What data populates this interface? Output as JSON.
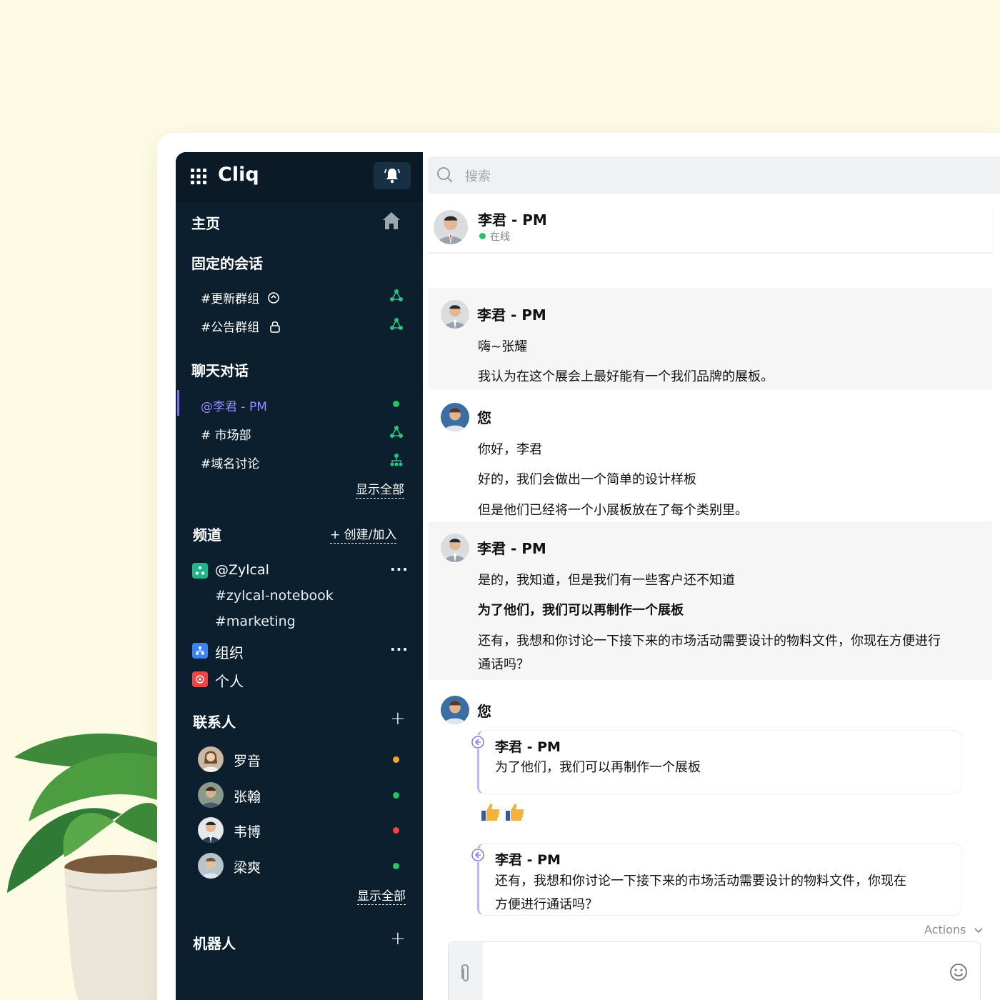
{
  "app": {
    "brand": "Cliq"
  },
  "sidebar": {
    "home": "主页",
    "pinned_title": "固定的会话",
    "pinned": [
      {
        "label": "#更新群组"
      },
      {
        "label": "#公告群组"
      }
    ],
    "chats_title": "聊天对话",
    "chats": [
      {
        "label": "@李君 - PM",
        "status_color": "#22c55e"
      },
      {
        "label": "# 市场部"
      },
      {
        "label": "#域名讨论"
      }
    ],
    "show_all": "显示全部",
    "channels_title": "频道",
    "create_join": "+   创建/加入",
    "channel_groups": [
      {
        "label": "@Zylcal",
        "color": "#1fb58a",
        "subs": [
          "#zylcal-notebook",
          "#marketing"
        ]
      },
      {
        "label": "组织",
        "color": "#3b82f6"
      },
      {
        "label": "个人",
        "color": "#ef4444"
      }
    ],
    "contacts_title": "联系人",
    "contacts": [
      {
        "name": "罗音",
        "status_color": "#f5a524"
      },
      {
        "name": "张翰",
        "status_color": "#22c55e"
      },
      {
        "name": "韦博",
        "status_color": "#ef4444"
      },
      {
        "name": "梁爽",
        "status_color": "#22c55e"
      }
    ],
    "show_all_contacts": "显示全部",
    "bots_title": "机器人"
  },
  "search": {
    "placeholder": "搜索"
  },
  "chat": {
    "header_name": "李君 - PM",
    "status": "在线",
    "messages": [
      {
        "sender": "李君 - PM",
        "lines": [
          "嗨~张耀",
          "我认为在这个展会上最好能有一个我们品牌的展板。"
        ]
      },
      {
        "sender": "您",
        "lines": [
          "你好，李君",
          "好的，我们会做出一个简单的设计样板",
          "但是他们已经将一个小展板放在了每个类别里。"
        ]
      },
      {
        "sender": "李君 - PM",
        "lines": [
          "是的，我知道，但是我们有一些客户还不知道",
          "为了他们，我们可以再制作一个展板",
          "还有，我想和你讨论一下接下来的市场活动需要设计的物料文件，你现在方便进行",
          "通话吗？"
        ]
      },
      {
        "sender": "您",
        "quotes": [
          {
            "name": "李君 - PM",
            "lines": [
              "为了他们，我们可以再制作一个展板"
            ]
          },
          {
            "name": "李君 - PM",
            "lines": [
              "还有，我想和你讨论一下接下来的市场活动需要设计的物料文件，你现在",
              "方便进行通话吗？"
            ]
          }
        ]
      }
    ],
    "actions_label": "Actions"
  },
  "colors": {
    "sidebar_bg": "#0b1f2e",
    "accent": "#7c6cf2",
    "online": "#22c55e"
  }
}
